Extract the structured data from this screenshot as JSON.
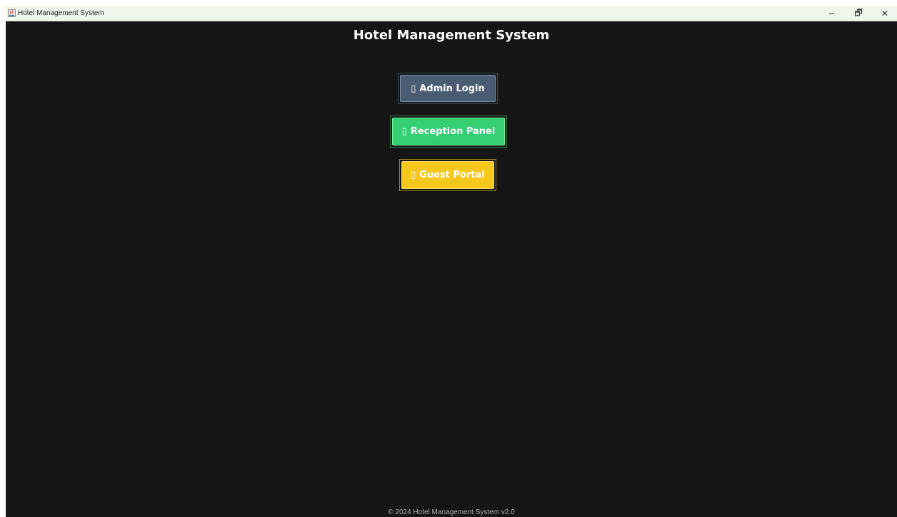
{
  "window": {
    "title": "Hotel Management System",
    "icon": "java-app-icon",
    "controls": {
      "minimize": "−",
      "maximize": "🗗",
      "close": "✕"
    }
  },
  "main": {
    "heading": "Hotel Management System",
    "buttons": [
      {
        "glyph": "▯",
        "label": "Admin Login",
        "color": "#4a5c72"
      },
      {
        "glyph": "▯",
        "label": "Reception Panel",
        "color": "#34cf72"
      },
      {
        "glyph": "▯",
        "label": "Guest Portal",
        "color": "#f6c81d"
      }
    ]
  },
  "footer": {
    "text": "© 2024 Hotel Management System v2.0"
  },
  "colors": {
    "background": "#151515",
    "titlebar": "#f1f6ea"
  }
}
